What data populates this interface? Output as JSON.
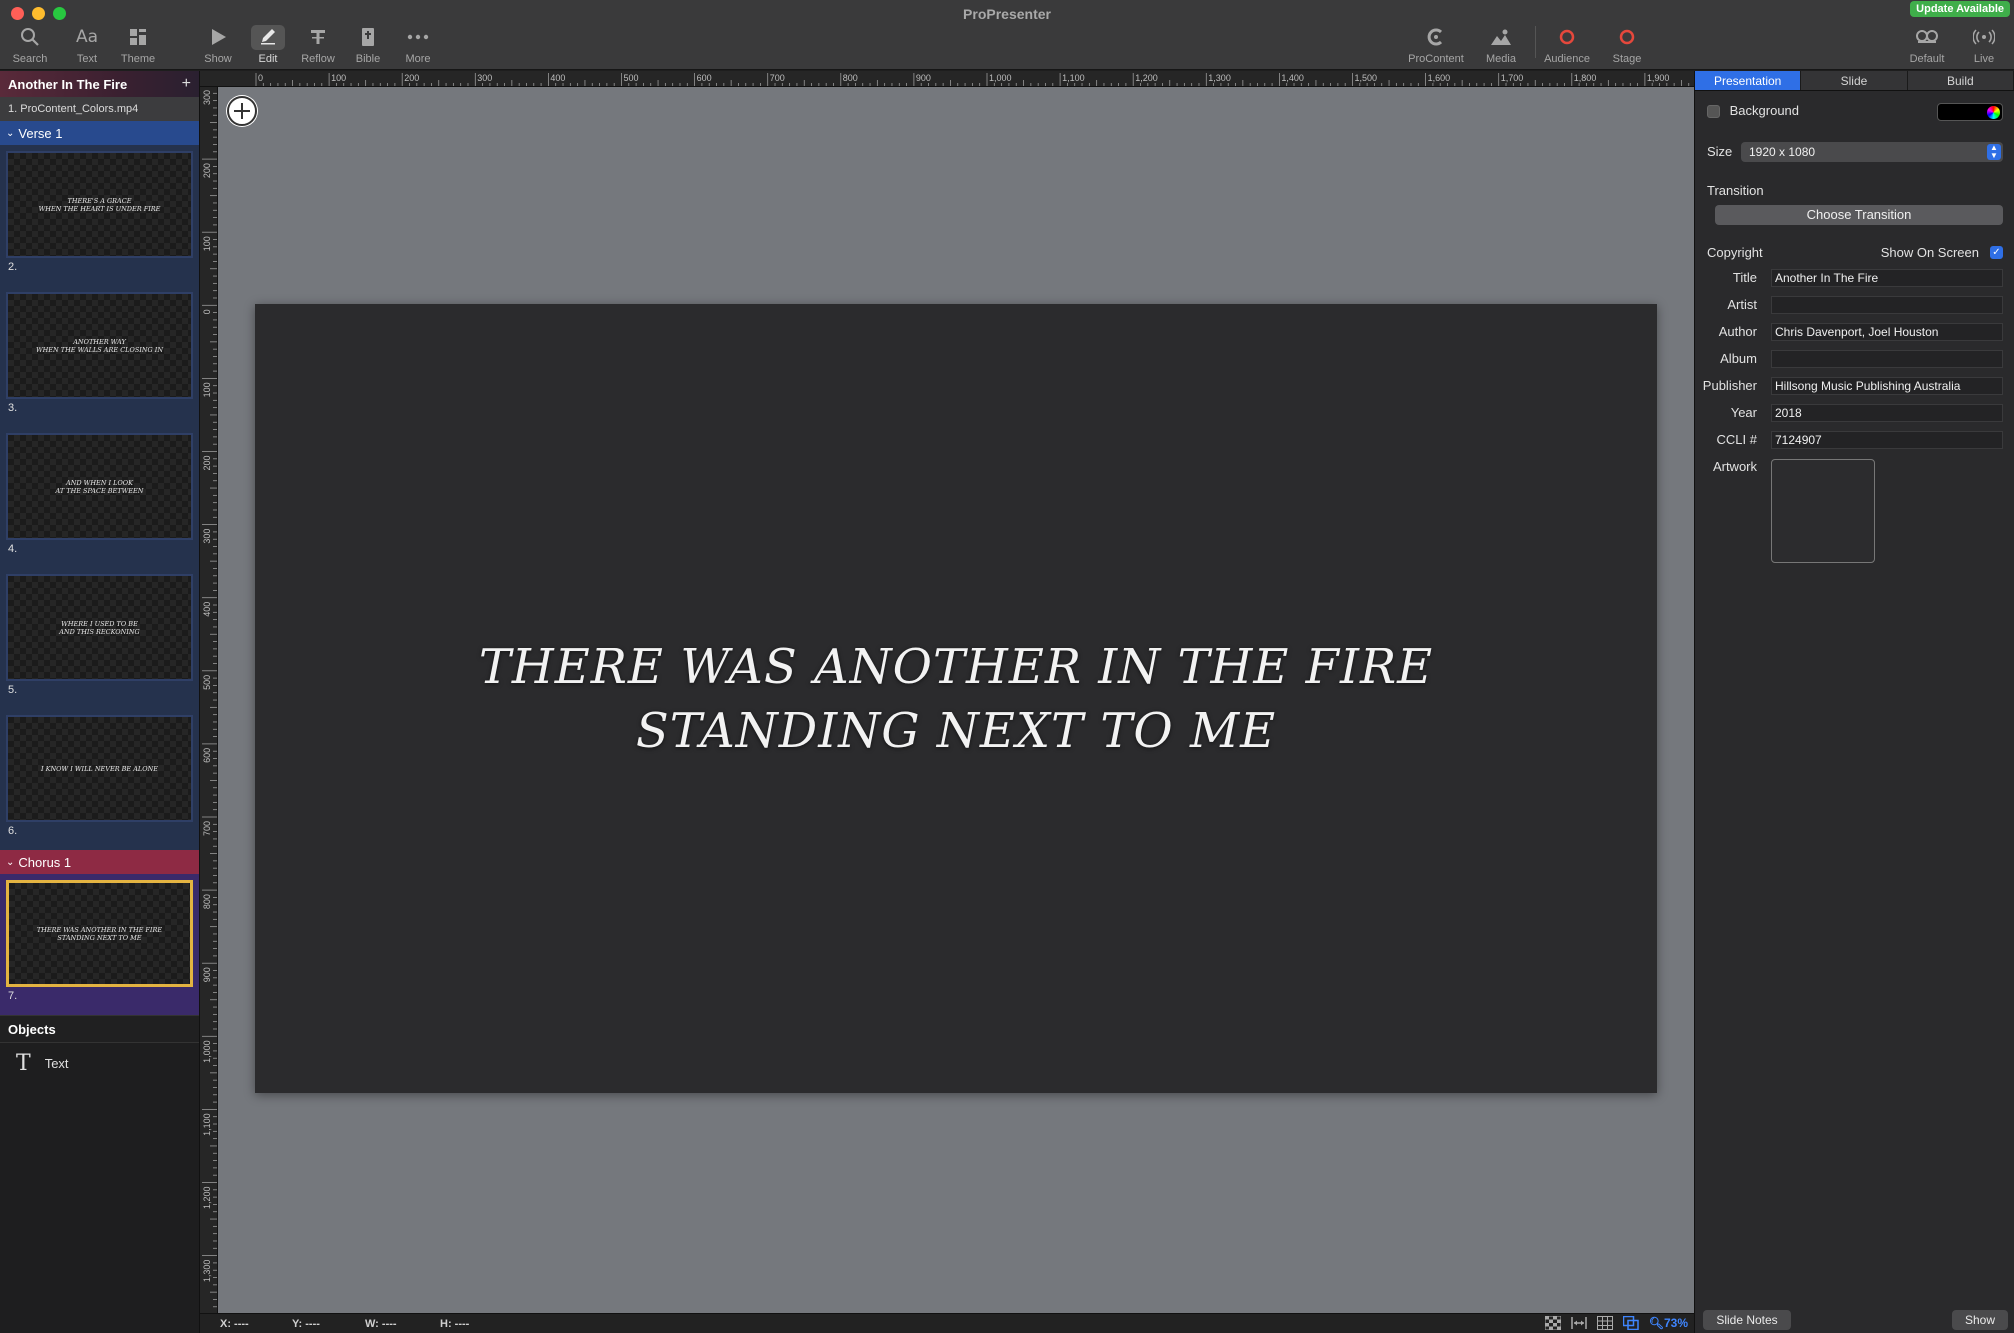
{
  "window": {
    "title": "ProPresenter",
    "update_badge": "Update Available"
  },
  "toolbar": {
    "left": [
      {
        "label": "Search",
        "icon": "search-icon"
      },
      {
        "label": "Text",
        "icon": "text-aa-icon"
      },
      {
        "label": "Theme",
        "icon": "theme-icon"
      }
    ],
    "center": [
      {
        "label": "Show",
        "icon": "play-icon"
      },
      {
        "label": "Edit",
        "icon": "pencil-icon"
      },
      {
        "label": "Reflow",
        "icon": "reflow-icon"
      },
      {
        "label": "Bible",
        "icon": "bible-icon"
      },
      {
        "label": "More",
        "icon": "ellipsis-icon"
      }
    ],
    "right": [
      {
        "label": "ProContent",
        "icon": "procontent-icon"
      },
      {
        "label": "Media",
        "icon": "media-icon"
      },
      {
        "label": "Audience",
        "icon": "audience-icon"
      },
      {
        "label": "Stage",
        "icon": "stage-icon"
      }
    ],
    "far_right": [
      {
        "label": "Default",
        "icon": "mask-icon"
      },
      {
        "label": "Live",
        "icon": "broadcast-icon"
      }
    ]
  },
  "sidebar": {
    "presentation_title": "Another In The Fire",
    "media_item": "1.  ProContent_Colors.mp4",
    "groups": [
      {
        "name": "Verse 1",
        "slides": [
          {
            "num": "2.",
            "text": "THERE'S A GRACE\nWHEN THE HEART IS UNDER FIRE"
          },
          {
            "num": "3.",
            "text": "ANOTHER WAY\nWHEN THE WALLS ARE CLOSING IN"
          },
          {
            "num": "4.",
            "text": "AND WHEN I LOOK\nAT THE SPACE BETWEEN"
          },
          {
            "num": "5.",
            "text": "WHERE I USED TO BE\nAND THIS RECKONING"
          },
          {
            "num": "6.",
            "text": "I KNOW I WILL NEVER BE ALONE"
          }
        ]
      },
      {
        "name": "Chorus 1",
        "slides": [
          {
            "num": "7.",
            "text": "THERE WAS ANOTHER IN THE FIRE\nSTANDING NEXT TO ME"
          }
        ]
      }
    ],
    "objects_label": "Objects",
    "objects": [
      {
        "label": "Text",
        "icon": "text-t-icon"
      }
    ]
  },
  "rulers": {
    "top_labels": [
      "0",
      "100",
      "200",
      "300",
      "400",
      "500",
      "600",
      "700",
      "800",
      "900",
      "1,000",
      "1,100",
      "1,200",
      "1,300",
      "1,400",
      "1,500",
      "1,600",
      "1,700",
      "1,800",
      "1,900"
    ],
    "left_labels": [
      "300",
      "200",
      "100",
      "0",
      "100",
      "200",
      "300",
      "400",
      "500",
      "600",
      "700",
      "800",
      "900",
      "1,000",
      "1,100",
      "1,200",
      "1,300"
    ]
  },
  "canvas": {
    "slide_text": "THERE WAS ANOTHER IN THE FIRE\nSTANDING NEXT TO ME"
  },
  "statusbar": {
    "x": "X: ----",
    "y": "Y: ----",
    "w": "W: ----",
    "h": "H: ----",
    "zoom": "73%"
  },
  "inspector": {
    "tabs": [
      "Presentation",
      "Slide",
      "Build"
    ],
    "background_label": "Background",
    "size_label": "Size",
    "size_value": "1920 x 1080",
    "transition_label": "Transition",
    "choose_transition": "Choose Transition",
    "copyright_label": "Copyright",
    "show_on_screen": "Show On Screen",
    "fields": [
      {
        "label": "Title",
        "value": "Another In The Fire"
      },
      {
        "label": "Artist",
        "value": ""
      },
      {
        "label": "Author",
        "value": "Chris Davenport, Joel Houston"
      },
      {
        "label": "Album",
        "value": ""
      },
      {
        "label": "Publisher",
        "value": "Hillsong Music Publishing Australia"
      },
      {
        "label": "Year",
        "value": "2018"
      },
      {
        "label": "CCLI #",
        "value": "7124907"
      }
    ],
    "artwork_label": "Artwork",
    "slide_notes": "Slide Notes",
    "show": "Show"
  },
  "colors": {
    "accent": "#2f6fe6",
    "verse_group": "#284a8e",
    "chorus_group": "#8e2a44",
    "selected_border": "#e3b341",
    "canvas_bg": "#75787d",
    "slide_bg": "#2b2b2d",
    "update_green": "#3fae4a",
    "red_icons": "#e5483c"
  }
}
